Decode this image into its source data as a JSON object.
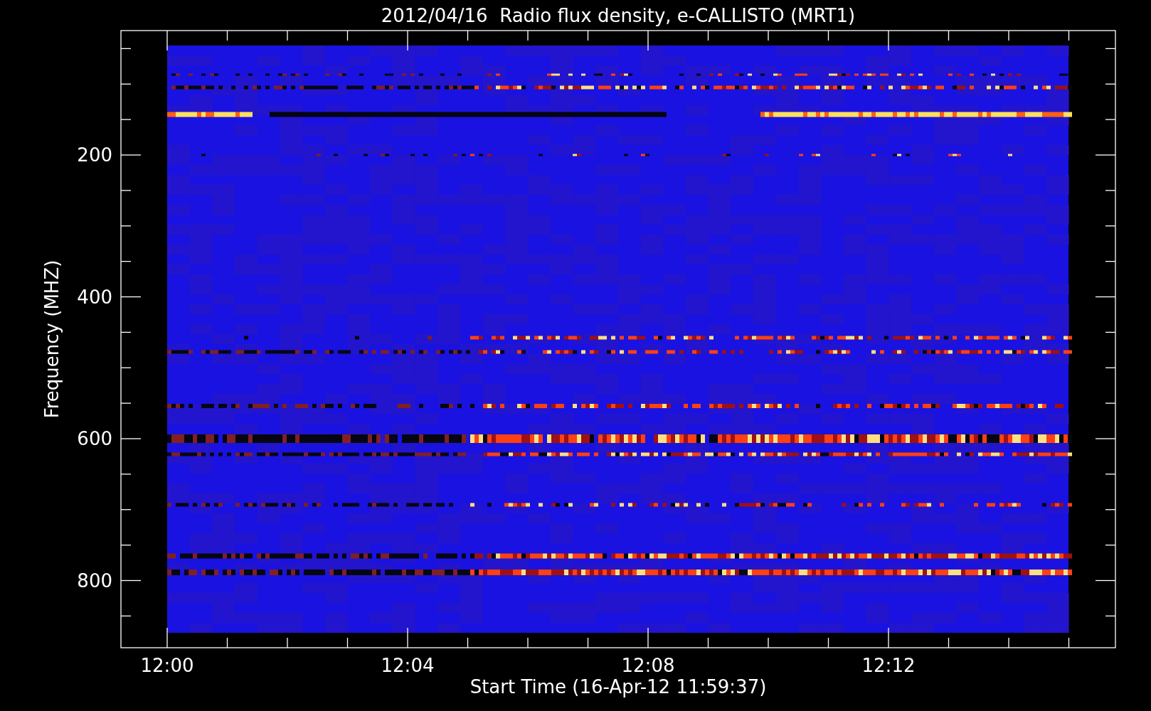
{
  "title": "2012/04/16  Radio flux density, e-CALLISTO (MRT1)",
  "plot": {
    "xlabel": "Start Time (16-Apr-12 11:59:37)",
    "ylabel": "Frequency (MHZ)",
    "x_tick_labels": [
      "12:00",
      "12:04",
      "12:08",
      "12:12"
    ],
    "y_tick_labels": [
      "200",
      "400",
      "600",
      "800"
    ]
  }
}
